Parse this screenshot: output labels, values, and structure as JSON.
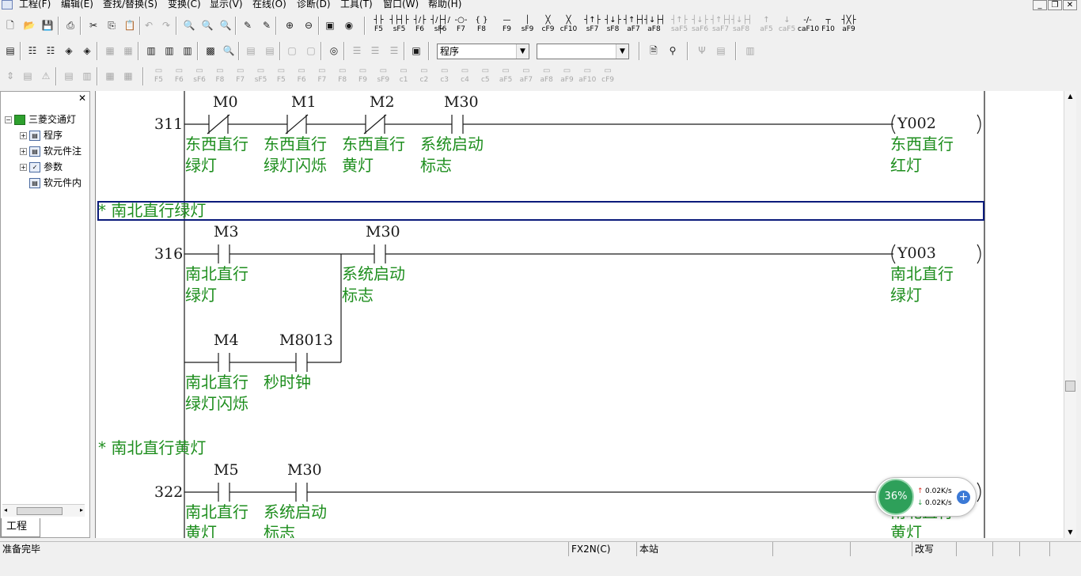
{
  "menu": {
    "items": [
      "工程(F)",
      "编辑(E)",
      "查找/替换(S)",
      "变换(C)",
      "显示(V)",
      "在线(O)",
      "诊断(D)",
      "工具(T)",
      "窗口(W)",
      "帮助(H)"
    ],
    "window_controls": [
      "minimize-icon",
      "restore-icon",
      "close-icon"
    ]
  },
  "toolbar": {
    "fkeys": [
      {
        "sym": "┤├",
        "label": "F5"
      },
      {
        "sym": "┤├┤├",
        "label": "sF5"
      },
      {
        "sym": "┤/├",
        "label": "F6"
      },
      {
        "sym": "┤/├┤/├",
        "label": "sF6"
      },
      {
        "sym": "-○-",
        "label": "F7"
      },
      {
        "sym": "{ }",
        "label": "F8"
      },
      {
        "sym": "—",
        "label": "F9"
      },
      {
        "sym": "│",
        "label": "sF9"
      },
      {
        "sym": "╳",
        "label": "cF9"
      },
      {
        "sym": "╳",
        "label": "cF10"
      },
      {
        "sym": "┤↑├",
        "label": "sF7"
      },
      {
        "sym": "┤↓├",
        "label": "sF8"
      },
      {
        "sym": "┤↑├┤",
        "label": "aF7"
      },
      {
        "sym": "┤↓├┤",
        "label": "aF8"
      },
      {
        "sym": "┤↑├",
        "label": "saF5"
      },
      {
        "sym": "┤↓├",
        "label": "saF6"
      },
      {
        "sym": "┤↑├┤",
        "label": "saF7"
      },
      {
        "sym": "┤↓├┤",
        "label": "saF8"
      },
      {
        "sym": "↑",
        "label": "aF5"
      },
      {
        "sym": "↓",
        "label": "caF5"
      },
      {
        "sym": "-/-",
        "label": "caF10"
      },
      {
        "sym": "┬",
        "label": "F10"
      },
      {
        "sym": "┤╳├",
        "label": "aF9"
      }
    ],
    "program_combo": "程序",
    "second_combo": "",
    "fkeys2": [
      {
        "label": "F5"
      },
      {
        "label": "F6"
      },
      {
        "label": "sF6"
      },
      {
        "label": "F8"
      },
      {
        "label": "F7"
      },
      {
        "label": "sF5"
      },
      {
        "label": "F5"
      },
      {
        "label": "F6"
      },
      {
        "label": "F7"
      },
      {
        "label": "F8"
      },
      {
        "label": "F9"
      },
      {
        "label": "sF9"
      },
      {
        "label": "c1"
      },
      {
        "label": "c2"
      },
      {
        "label": "c3"
      },
      {
        "label": "c4"
      },
      {
        "label": "c5"
      },
      {
        "label": "aF5"
      },
      {
        "label": "aF7"
      },
      {
        "label": "aF8"
      },
      {
        "label": "aF9"
      },
      {
        "label": "aF10"
      },
      {
        "label": "cF9"
      }
    ]
  },
  "project_tree": {
    "root": "三菱交通灯",
    "items": [
      "程序",
      "软元件注",
      "参数",
      "软元件内"
    ],
    "tab": "工程"
  },
  "ladder": {
    "rungs": [
      {
        "step": "311",
        "contacts": [
          {
            "device": "M0",
            "type": "NC",
            "comment": [
              "东西直行",
              "绿灯"
            ]
          },
          {
            "device": "M1",
            "type": "NC",
            "comment": [
              "东西直行",
              "绿灯闪烁"
            ]
          },
          {
            "device": "M2",
            "type": "NC",
            "comment": [
              "东西直行",
              "黄灯"
            ]
          },
          {
            "device": "M30",
            "type": "NO",
            "comment": [
              "系统启动",
              "标志"
            ]
          }
        ],
        "coil": {
          "device": "Y002",
          "comment": [
            "东西直行",
            "红灯"
          ]
        }
      },
      {
        "statement": "*  南北直行绿灯",
        "step": "316",
        "contacts": [
          {
            "device": "M3",
            "type": "NO",
            "comment": [
              "南北直行",
              "绿灯"
            ]
          },
          {
            "device": "M30",
            "type": "NO",
            "comment": [
              "系统启动",
              "标志"
            ]
          },
          {
            "device": "M4",
            "type": "NO",
            "comment": [
              "南北直行",
              "绿灯闪烁"
            ]
          },
          {
            "device": "M8013",
            "type": "NO",
            "comment": [
              "秒时钟"
            ]
          }
        ],
        "coil": {
          "device": "Y003",
          "comment": [
            "南北直行",
            "绿灯"
          ]
        }
      },
      {
        "statement": "*  南北直行黄灯",
        "step": "322",
        "contacts": [
          {
            "device": "M5",
            "type": "NO",
            "comment": [
              "南北直行",
              "黄灯"
            ]
          },
          {
            "device": "M30",
            "type": "NO",
            "comment": [
              "系统启动",
              "标志"
            ]
          }
        ],
        "coil": {
          "device": "",
          "comment": [
            "南北直行",
            "黄灯"
          ]
        }
      }
    ]
  },
  "status": {
    "message": "准备完毕",
    "plc_type": "FX2N(C)",
    "station": "本站",
    "mode": "改写"
  },
  "net_widget": {
    "percent": "36%",
    "upload": "0.02K/s",
    "download": "0.02K/s",
    "accent": "#2ea05a"
  }
}
